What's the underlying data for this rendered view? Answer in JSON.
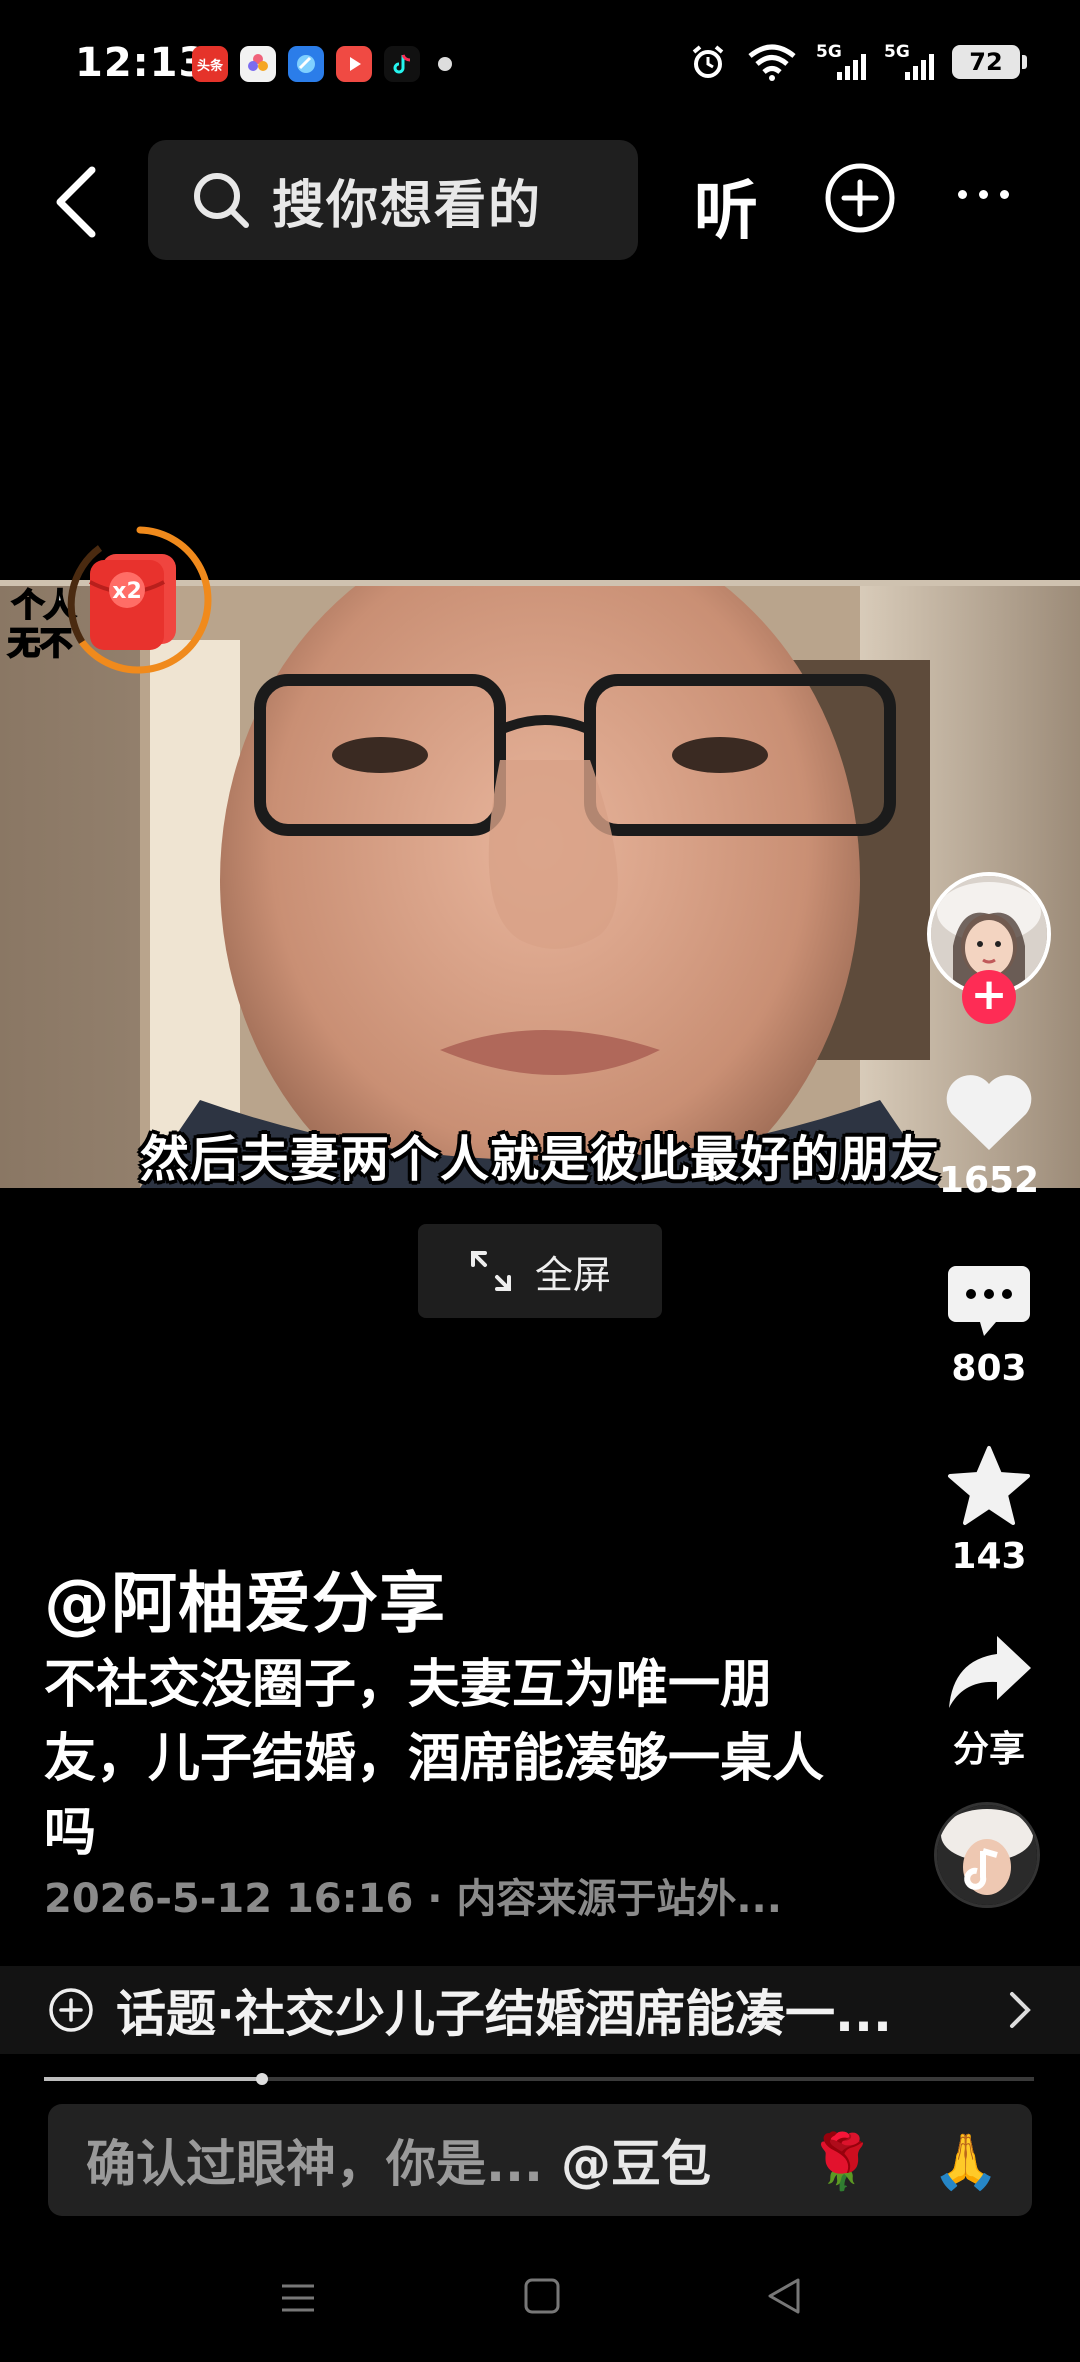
{
  "status_bar": {
    "time": "12:13",
    "notification_apps": [
      {
        "icon": "toutiao-app-icon",
        "label": "头条",
        "color": "#e5332a"
      },
      {
        "icon": "flower-app-icon",
        "label": "",
        "color": "#e94f5b"
      },
      {
        "icon": "browser-app-icon",
        "label": "",
        "color": "#2b7de9"
      },
      {
        "icon": "video-app-icon",
        "label": "",
        "color": "#f04a43"
      },
      {
        "icon": "tiktok-app-icon",
        "label": "",
        "color": "#111111"
      }
    ],
    "signal_1_label": "5G",
    "signal_2_label": "5G",
    "battery": "72"
  },
  "top_nav": {
    "search_placeholder": "搜你想看的",
    "listen_label": "听"
  },
  "video": {
    "subtitle": "然后夫妻两个人就是彼此最好的朋友",
    "red_packet_badge": "x2",
    "corner_caption_1": "个人",
    "corner_caption_2": "无不"
  },
  "fullscreen_label": "全屏",
  "rail": {
    "likes": "1652",
    "comments": "803",
    "favorites": "143",
    "share_label": "分享"
  },
  "caption": {
    "author": "@阿柚爱分享",
    "description": "不社交没圈子，夫妻互为唯一朋友，儿子结婚，酒席能凑够一桌人吗",
    "meta": "2026-5-12 16:16 · 内容来源于站外..."
  },
  "topic_label": "话题·社交少儿子结婚酒席能凑一...",
  "progress": 0.22,
  "comment_bar": {
    "placeholder": "确认过眼神，你是...",
    "mention": "@豆包",
    "emoji_1": "🌹",
    "emoji_2": "🙏"
  }
}
